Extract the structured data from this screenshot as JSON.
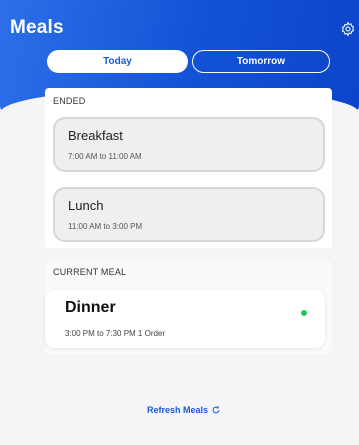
{
  "header": {
    "title": "Meals",
    "settings_icon": "gear-icon"
  },
  "tabs": [
    {
      "label": "Today",
      "selected": true
    },
    {
      "label": "Tomorrow",
      "selected": false
    }
  ],
  "ended": {
    "label": "ENDED",
    "meals": [
      {
        "name": "Breakfast",
        "time": "7:00 AM to 11:00 AM"
      },
      {
        "name": "Lunch",
        "time": "11:00 AM to 3:00 PM"
      }
    ]
  },
  "current": {
    "label": "CURRENT MEAL",
    "meal": {
      "name": "Dinner",
      "details": "3:00 PM to 7:30 PM 1 Order",
      "status_color": "#22c55e"
    }
  },
  "refresh": {
    "label": "Refresh Meals",
    "icon": "refresh-icon"
  },
  "colors": {
    "accent": "#1a5adb",
    "header_start": "#2d6fe8",
    "header_end": "#0b45c9"
  }
}
